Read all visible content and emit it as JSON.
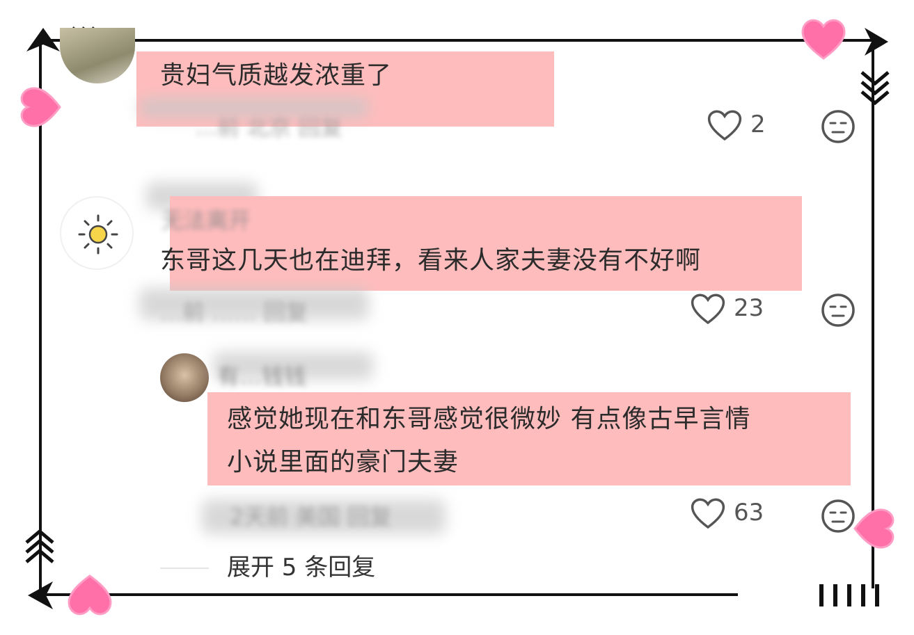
{
  "comments": [
    {
      "text": "贵妇气质越发浓重了",
      "meta": "…前 北京 回复",
      "likes": "2"
    },
    {
      "username": "无法离开",
      "text": "东哥这几天也在迪拜，看来人家夫妻没有不好啊",
      "meta": "…前 …… 回复",
      "likes": "23"
    },
    {
      "username": "有…钱钱",
      "text_line1": "感觉她现在和东哥感觉很微妙 有点像古早言情",
      "text_line2": "小说里面的豪门夫妻",
      "meta": "2天前 美国 回复",
      "likes": "63"
    }
  ],
  "expand": {
    "label": "展开 5 条回复"
  },
  "colors": {
    "highlight": "#ffbcbd",
    "heart_pink": "#ff6fa8",
    "frame": "#111111"
  }
}
